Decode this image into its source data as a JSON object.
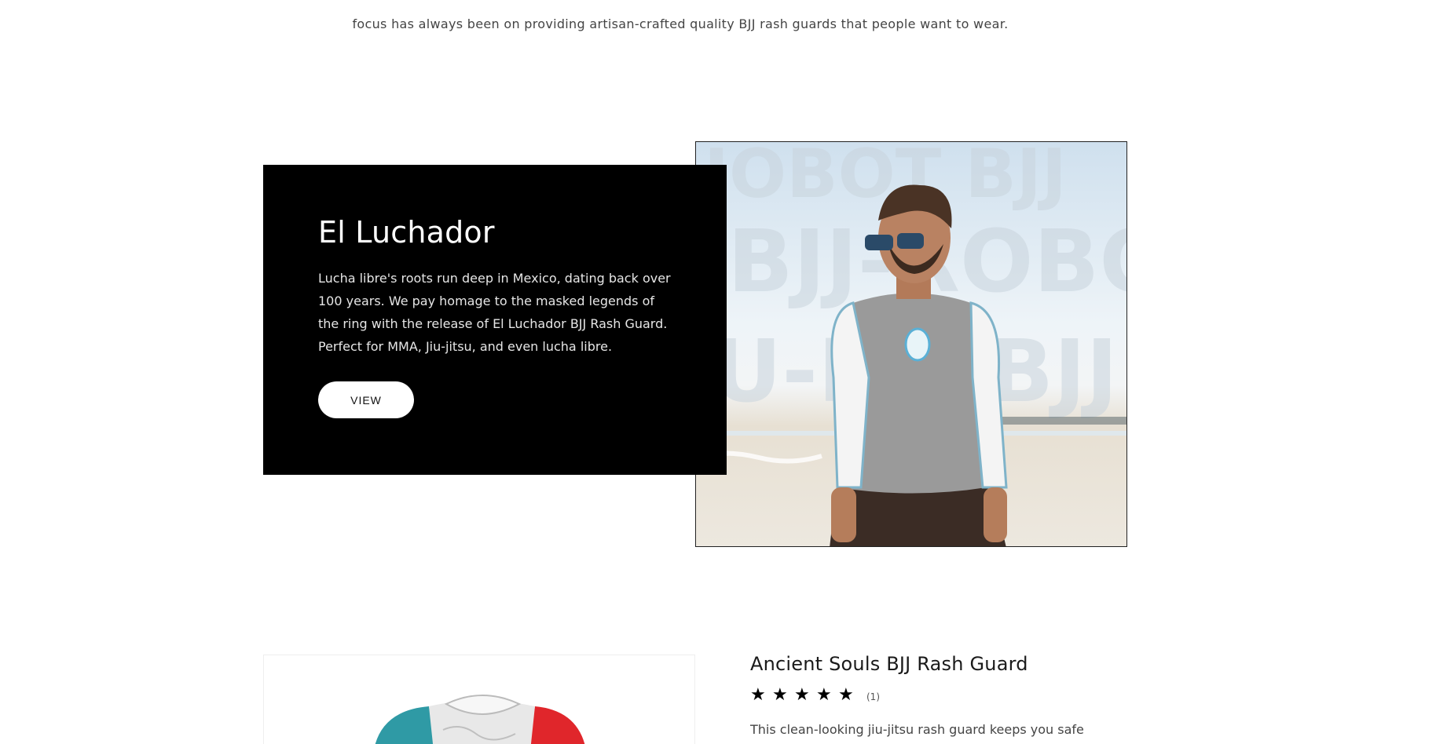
{
  "intro": {
    "text": "focus has always been on providing artisan-crafted quality BJJ rash guards that people want to wear."
  },
  "feature": {
    "title": "El Luchador",
    "description": "Lucha libre's roots run deep in Mexico, dating back over 100 years. We pay homage to the masked legends of the ring with the release of El Luchador BJJ Rash Guard. Perfect for MMA, Jiu-jitsu, and even lucha libre.",
    "button_label": "VIEW",
    "image_watermark": "JIU-ROBOT BJJ",
    "colors": {
      "panel": "#000000",
      "button": "#ffffff"
    }
  },
  "product": {
    "title": "Ancient Souls BJJ Rash Guard",
    "rating_stars": 5,
    "rating_count": "(1)",
    "description": "This clean-looking jiu-jitsu rash guard keeps you safe",
    "stars": [
      "★",
      "★",
      "★",
      "★",
      "★"
    ]
  }
}
